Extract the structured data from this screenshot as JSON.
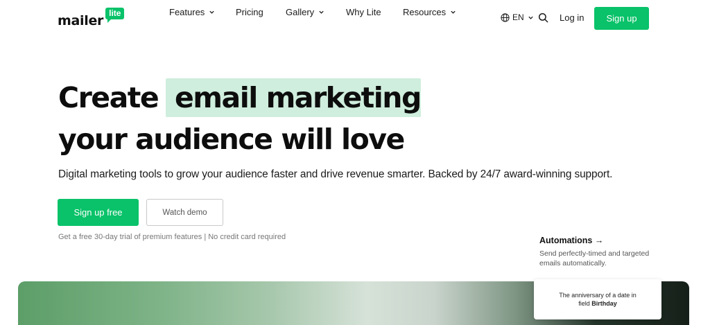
{
  "brand": {
    "name": "mailer",
    "badge": "lite",
    "accent_color": "#09c269",
    "highlight_color": "#cfeedd"
  },
  "nav": {
    "items": [
      {
        "label": "Features",
        "has_dropdown": true
      },
      {
        "label": "Pricing",
        "has_dropdown": false
      },
      {
        "label": "Gallery",
        "has_dropdown": true
      },
      {
        "label": "Why Lite",
        "has_dropdown": false
      },
      {
        "label": "Resources",
        "has_dropdown": true
      }
    ],
    "language": "EN",
    "login": "Log in",
    "signup": "Sign up"
  },
  "hero": {
    "title_prefix": "Create",
    "title_highlight": "email marketing",
    "title_line2": "your audience will love",
    "subtitle": "Digital marketing tools to grow your audience faster and drive revenue smarter. Backed by 24/7 award-winning support.",
    "primary_cta": "Sign up free",
    "secondary_cta": "Watch demo",
    "note": "Get a free 30-day trial of premium features | No credit card required"
  },
  "feature_callout": {
    "title": "Automations",
    "arrow": "→",
    "description": "Send perfectly-timed and targeted emails automatically."
  },
  "card": {
    "line1": "The anniversary of a date in",
    "line2_prefix": "field",
    "line2_field": "Birthday"
  }
}
